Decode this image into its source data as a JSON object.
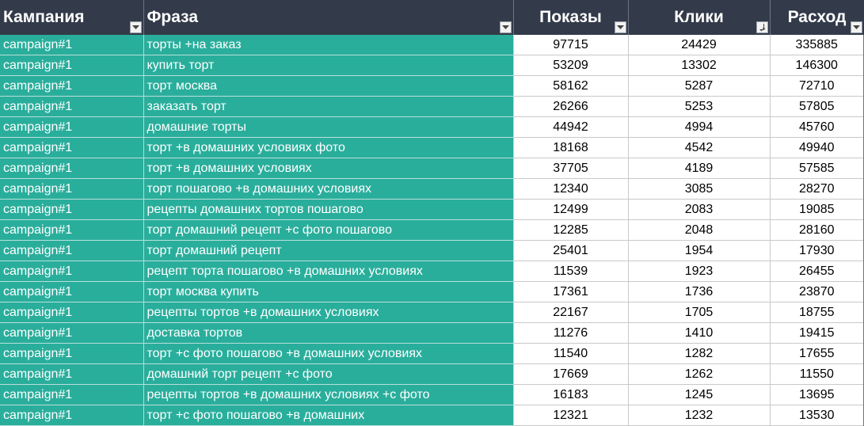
{
  "headers": {
    "campaign": "Кампания",
    "phrase": "Фраза",
    "impressions": "Показы",
    "clicks": "Клики",
    "cost": "Расход"
  },
  "rows": [
    {
      "campaign": "campaign#1",
      "phrase": "торты +на заказ",
      "impressions": "97715",
      "clicks": "24429",
      "cost": "335885"
    },
    {
      "campaign": "campaign#1",
      "phrase": "купить торт",
      "impressions": "53209",
      "clicks": "13302",
      "cost": "146300"
    },
    {
      "campaign": "campaign#1",
      "phrase": "торт москва",
      "impressions": "58162",
      "clicks": "5287",
      "cost": "72710"
    },
    {
      "campaign": "campaign#1",
      "phrase": "заказать торт",
      "impressions": "26266",
      "clicks": "5253",
      "cost": "57805"
    },
    {
      "campaign": "campaign#1",
      "phrase": "домашние торты",
      "impressions": "44942",
      "clicks": "4994",
      "cost": "45760"
    },
    {
      "campaign": "campaign#1",
      "phrase": "торт +в домашних условиях фото",
      "impressions": "18168",
      "clicks": "4542",
      "cost": "49940"
    },
    {
      "campaign": "campaign#1",
      "phrase": "торт +в домашних условиях",
      "impressions": "37705",
      "clicks": "4189",
      "cost": "57585"
    },
    {
      "campaign": "campaign#1",
      "phrase": "торт пошагово +в домашних условиях",
      "impressions": "12340",
      "clicks": "3085",
      "cost": "28270"
    },
    {
      "campaign": "campaign#1",
      "phrase": "рецепты домашних тортов пошагово",
      "impressions": "12499",
      "clicks": "2083",
      "cost": "19085"
    },
    {
      "campaign": "campaign#1",
      "phrase": "торт домашний рецепт +с фото пошагово",
      "impressions": "12285",
      "clicks": "2048",
      "cost": "28160"
    },
    {
      "campaign": "campaign#1",
      "phrase": "торт домашний рецепт",
      "impressions": "25401",
      "clicks": "1954",
      "cost": "17930"
    },
    {
      "campaign": "campaign#1",
      "phrase": "рецепт торта пошагово +в домашних условиях",
      "impressions": "11539",
      "clicks": "1923",
      "cost": "26455"
    },
    {
      "campaign": "campaign#1",
      "phrase": "торт москва купить",
      "impressions": "17361",
      "clicks": "1736",
      "cost": "23870"
    },
    {
      "campaign": "campaign#1",
      "phrase": "рецепты тортов +в домашних условиях",
      "impressions": "22167",
      "clicks": "1705",
      "cost": "18755"
    },
    {
      "campaign": "campaign#1",
      "phrase": "доставка тортов",
      "impressions": "11276",
      "clicks": "1410",
      "cost": "19415"
    },
    {
      "campaign": "campaign#1",
      "phrase": "торт +с фото пошагово +в домашних условиях",
      "impressions": "11540",
      "clicks": "1282",
      "cost": "17655"
    },
    {
      "campaign": "campaign#1",
      "phrase": "домашний торт рецепт +с фото",
      "impressions": "17669",
      "clicks": "1262",
      "cost": "11550"
    },
    {
      "campaign": "campaign#1",
      "phrase": "рецепты тортов +в домашних условиях +с фото",
      "impressions": "16183",
      "clicks": "1245",
      "cost": "13695"
    },
    {
      "campaign": "campaign#1",
      "phrase": "торт +с фото пошагово +в домашних",
      "impressions": "12321",
      "clicks": "1232",
      "cost": "13530"
    }
  ],
  "filters": {
    "campaign": "filter-dropdown-icon",
    "phrase": "filter-dropdown-icon",
    "impressions": "filter-dropdown-icon",
    "clicks": "sort-descending-filter-icon",
    "cost": "filter-dropdown-icon"
  },
  "colors": {
    "header_bg": "#333a4a",
    "text_cell_bg": "#2aae9c",
    "selection_border": "#21a366"
  }
}
